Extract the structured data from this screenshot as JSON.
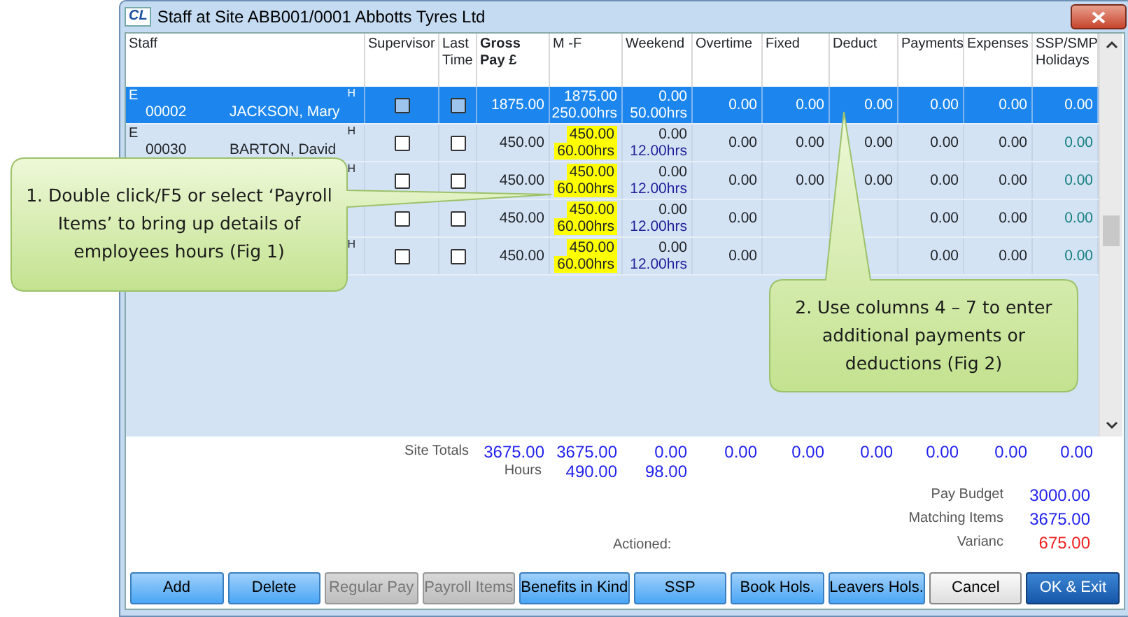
{
  "window": {
    "app_icon": "CL",
    "title": "Staff at Site ABB001/0001 Abbotts Tyres Ltd"
  },
  "table": {
    "columns": [
      {
        "label": "Staff",
        "bold": false
      },
      {
        "label": "Supervisor",
        "bold": false
      },
      {
        "label": "Last Time",
        "bold": false
      },
      {
        "label": "Gross Pay £",
        "bold": true
      },
      {
        "label": "M -F",
        "bold": false
      },
      {
        "label": "Weekend",
        "bold": false
      },
      {
        "label": "Overtime",
        "bold": false
      },
      {
        "label": "Fixed",
        "bold": false
      },
      {
        "label": "Deduct",
        "bold": false
      },
      {
        "label": "Payments",
        "bold": false
      },
      {
        "label": "Expenses",
        "bold": false
      },
      {
        "label": "SSP/SMP Holidays",
        "bold": false
      }
    ],
    "rows": [
      {
        "selected": true,
        "flag": "E",
        "code": "00002",
        "name": "JACKSON, Mary",
        "marker": "H",
        "supervisor": false,
        "last_time": false,
        "gross": "1875.00",
        "mf": "1875.00",
        "mf_hours": "250.00hrs",
        "mf_highlighted": false,
        "weekend": "0.00",
        "weekend_hours": "50.00hrs",
        "overtime": "0.00",
        "fixed": "0.00",
        "deduct": "0.00",
        "payments": "0.00",
        "expenses": "0.00",
        "ssp": "0.00"
      },
      {
        "selected": false,
        "flag": "E",
        "code": "00030",
        "name": "BARTON, David",
        "marker": "H",
        "supervisor": false,
        "last_time": false,
        "gross": "450.00",
        "mf": "450.00",
        "mf_hours": "60.00hrs",
        "mf_highlighted": true,
        "weekend": "0.00",
        "weekend_hours": "12.00hrs",
        "overtime": "0.00",
        "fixed": "0.00",
        "deduct": "0.00",
        "payments": "0.00",
        "expenses": "0.00",
        "ssp": "0.00"
      },
      {
        "selected": false,
        "marker": "H",
        "supervisor": false,
        "last_time": false,
        "gross": "450.00",
        "mf": "450.00",
        "mf_hours": "60.00hrs",
        "mf_highlighted": true,
        "weekend": "0.00",
        "weekend_hours": "12.00hrs",
        "overtime": "0.00",
        "fixed": "0.00",
        "deduct": "0.00",
        "payments": "0.00",
        "expenses": "0.00",
        "ssp": "0.00"
      },
      {
        "selected": false,
        "supervisor": false,
        "last_time": false,
        "gross": "450.00",
        "mf": "450.00",
        "mf_hours": "60.00hrs",
        "mf_highlighted": true,
        "weekend": "0.00",
        "weekend_hours": "12.00hrs",
        "overtime": "0.00",
        "payments": "0.00",
        "expenses": "0.00",
        "ssp": "0.00"
      },
      {
        "selected": false,
        "marker": "H",
        "supervisor": false,
        "last_time": false,
        "gross": "450.00",
        "mf": "450.00",
        "mf_hours": "60.00hrs",
        "mf_highlighted": true,
        "weekend": "0.00",
        "weekend_hours": "12.00hrs",
        "overtime": "0.00",
        "payments": "0.00",
        "expenses": "0.00",
        "ssp": "0.00"
      }
    ]
  },
  "totals": {
    "label": "Site Totals",
    "values": [
      "3675.00",
      "3675.00",
      "0.00",
      "0.00",
      "0.00",
      "0.00",
      "0.00",
      "0.00",
      "0.00"
    ],
    "hours_label": "Hours",
    "hours": [
      "490.00",
      "98.00"
    ]
  },
  "summary": [
    {
      "label": "Pay Budget",
      "value": "3000.00",
      "negative": false
    },
    {
      "label": "Matching Items",
      "value": "3675.00",
      "negative": false
    },
    {
      "label": "Varianc",
      "value": "675.00",
      "negative": true
    }
  ],
  "actioned": "Actioned:",
  "buttons": [
    {
      "label": "Add",
      "kind": "normal",
      "disabled": false
    },
    {
      "label": "Delete",
      "kind": "normal",
      "disabled": false
    },
    {
      "label": "Regular Pay",
      "kind": "normal",
      "disabled": true
    },
    {
      "label": "Payroll Items",
      "kind": "normal",
      "disabled": true
    },
    {
      "label": "Benefits in Kind",
      "kind": "normal",
      "disabled": false
    },
    {
      "label": "SSP",
      "kind": "normal",
      "disabled": false
    },
    {
      "label": "Book Hols.",
      "kind": "normal",
      "disabled": false
    },
    {
      "label": "Leavers Hols.",
      "kind": "normal",
      "disabled": false
    },
    {
      "label": "Cancel",
      "kind": "cancel",
      "disabled": false
    },
    {
      "label": "OK & Exit",
      "kind": "default",
      "disabled": false
    }
  ],
  "callouts": [
    {
      "text": "1. Double click/F5 or select ‘Payroll Items’ to bring up details of employees hours (Fig 1)"
    },
    {
      "text": "2. Use columns 4 – 7 to enter additional payments or deductions (Fig 2)"
    }
  ]
}
